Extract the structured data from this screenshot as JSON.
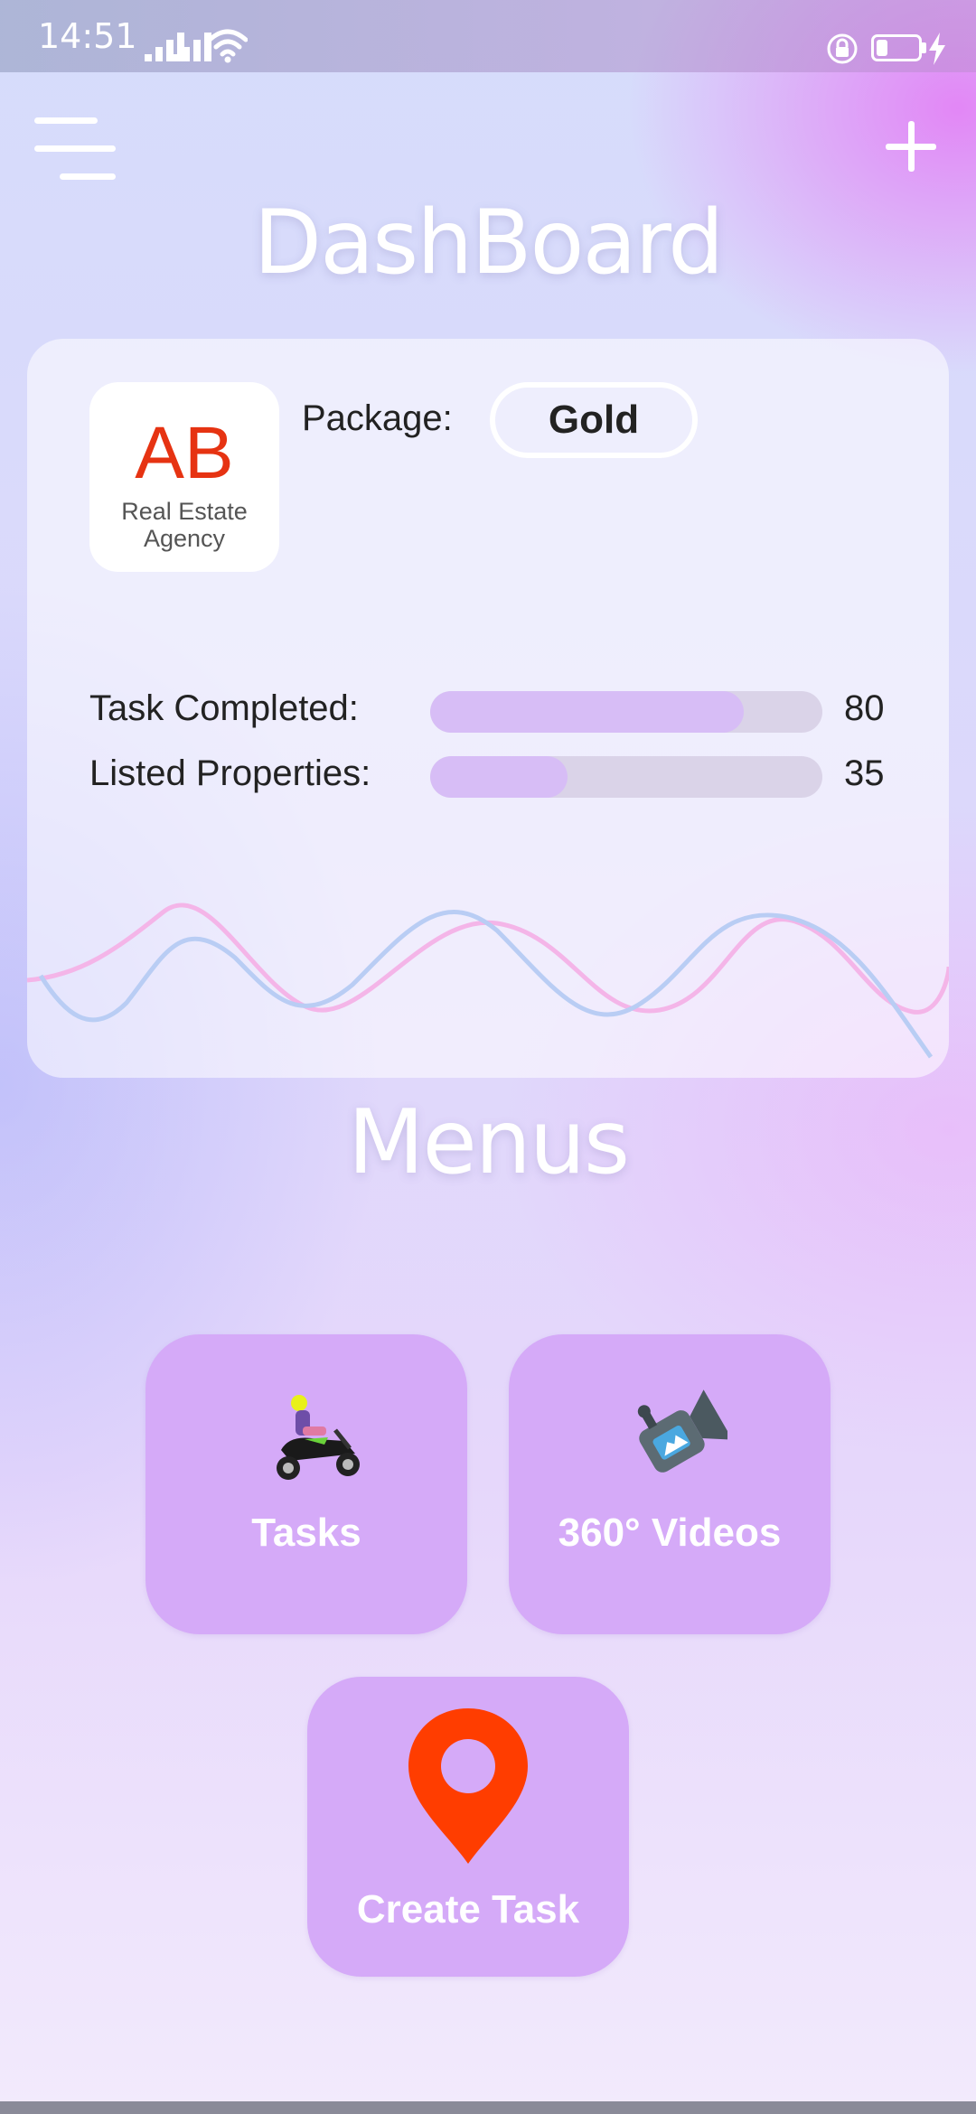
{
  "status_bar": {
    "time": "14:51"
  },
  "header": {
    "title": "DashBoard"
  },
  "card": {
    "logo": {
      "letters": "AB",
      "subtitle_line1": "Real Estate",
      "subtitle_line2": "Agency"
    },
    "package_label": "Package:",
    "package_value": "Gold",
    "stats": [
      {
        "label": "Task Completed:",
        "value": "80",
        "progress_percent": 80
      },
      {
        "label": "Listed Properties:",
        "value": "35",
        "progress_percent": 35
      }
    ]
  },
  "menus": {
    "title": "Menus",
    "items": [
      {
        "label": "Tasks",
        "icon": "scooter-rider-icon"
      },
      {
        "label": "360° Videos",
        "icon": "video-camera-icon"
      },
      {
        "label": "Create Task",
        "icon": "map-pin-icon"
      }
    ]
  },
  "colors": {
    "accent_tile": "#d5aaf8",
    "progress_fill": "#d7bdf6",
    "pin_red": "#ff3d00",
    "logo_red": "#e63312"
  }
}
